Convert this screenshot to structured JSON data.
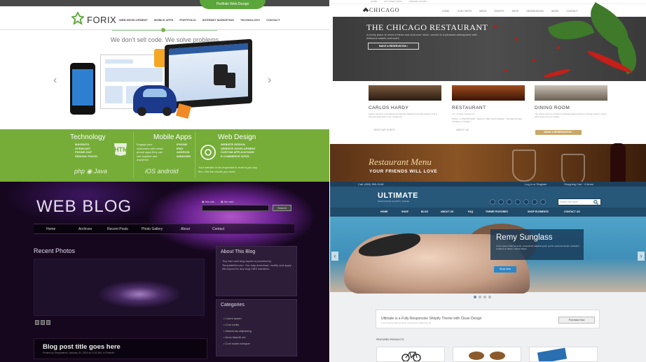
{
  "forix": {
    "badge": "Portfolio Web Design",
    "logo": "FORIX",
    "nav": [
      "WEB DEVELOPMENT",
      "MOBILE APPS",
      "PORTFOLIO",
      "INTERNET MARKETING",
      "TECHNOLOGY",
      "CONTACT"
    ],
    "tagline": "We don't sell code. We solve problems",
    "prev": "‹",
    "next": "›",
    "technology": {
      "title": "Technology",
      "items": [
        "MAGENTO",
        "OPENCART",
        "PHONE GAP",
        "SENCHA TOUCH"
      ],
      "badge": "HTML",
      "logos": "php  ◉  Java"
    },
    "mobile": {
      "title": "Mobile Apps",
      "text": "Engage your customers with smart phone apps they can use anytime and anywhere",
      "items": [
        "IPHONE",
        "IPAD",
        "ANDROID",
        "WINDOWS"
      ],
      "logos": "iOS   android"
    },
    "webdesign": {
      "title": "Web Design",
      "items": [
        "WEBSITE DESIGN",
        "WEBSITE DEVELOPMENT",
        "CUSTOM APPLICATIONS",
        "E-COMMERCE SITES"
      ],
      "text": "Your website is too important to trust to just any firm. Get the results you need"
    },
    "colors": {
      "brand_green": "#75ad38"
    }
  },
  "chicago": {
    "toplinks": [
      "HOME",
      "GET DIRECTIONS",
      "OPENING HOURS"
    ],
    "logo": "CHICAGO",
    "nav": [
      "HOME",
      "OUR CHEFS",
      "MENU",
      "EVENTS",
      "SHOP",
      "RESERVATION",
      "NEWS",
      "CONTACT"
    ],
    "hero_title": "THE CHICAGO RESTAURANT",
    "hero_sub": "A lovely place to meet a friend and chat over lunch, served in a pleasant atmosphere with delicious salads and sushi.",
    "hero_button": "MAKE A RESERVATION ›",
    "cards": [
      {
        "title": "CARLOS HARDY",
        "pre": "",
        "text": "Carlos was born and raised and had the brightest personal integrity and is now the head chef of our restaurant.",
        "link": "VIEW OUR CHEFS"
      },
      {
        "title": "RESTAURANT",
        "pre": "The Chicago Restaurant",
        "text": "Phone: +1 650 555 0188 · Address: 1800 South Wabash · Monday-Sunday: 10:00am to 10:00pm",
        "link": "ABOUT US"
      },
      {
        "title": "DINING ROOM",
        "pre": "",
        "text": "The dining room by Ambient is already again known to Chicago diners, where often every room is unique.",
        "button": "MAKE A RESERVATION ›"
      }
    ],
    "banner_script": "Restaurant Menu",
    "banner_caps": "YOUR FRIENDS WILL LOVE"
  },
  "blog": {
    "title": "WEB BLOG",
    "radio_1": "this site",
    "radio_2": "the web",
    "search_button": "Search",
    "nav": [
      "Home",
      "Archives",
      "Recent Posts",
      "Photo Gallery",
      "About",
      "Contact"
    ],
    "recent_photos": "Recent Photos",
    "about_title": "About This Blog",
    "about_text": "Tiny free web blog layout is provided by TemplateMo.com. You may download, modify and apply this layout for any blog CMS websites.",
    "categories_title": "Categories",
    "categories": [
      "Lorem ipsum",
      "Cum mollis",
      "Maecenas adipiscing",
      "Nunc blandit unt",
      "Cum sociis natoque"
    ],
    "post_title": "Blog post title goes here",
    "post_meta": "Posted by Templatemo, January 31, 2024 at 11:32 AM, in Portfolio",
    "photo_pager": [
      "1",
      "2",
      "3"
    ]
  },
  "ultimate": {
    "contact": "Call: (650) 555-0148",
    "login": "Log in  or  Register",
    "cart": "Shopping Cart · 0 items",
    "logo": "ULTIMATE",
    "logo_sub": "RESPONSIVE SHOPIFY THEME",
    "search_placeholder": "Search the store",
    "nav": [
      "HOME",
      "SHOP",
      "BLOG",
      "ABOUT US",
      "FAQ",
      "THEME FEATURES",
      "SHOP ELEMENTS",
      "CONTACT US"
    ],
    "slide_title": "Remy Sunglass",
    "slide_text": "Lorem ipsum dolor sit amet, consectetur adipiscing elit, sed do eiusmod tempor incididunt ut labore et dolore magna aliqua.",
    "slide_button": "Shop Now",
    "promo": "Ultimate is a Fully Responsive Shopify Theme with Clean Design",
    "promo_sub": "Lorem ipsum dolor sit amet consectetur adipiscing elit",
    "promo_button": "Purchase Now",
    "featured": "FEATURED PRODUCTS",
    "prev": "‹",
    "next": "›"
  }
}
